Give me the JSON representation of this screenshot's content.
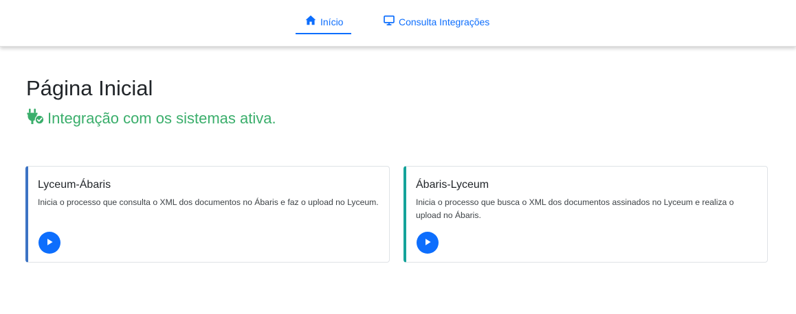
{
  "nav": {
    "items": [
      {
        "label": "Início",
        "icon": "home-icon",
        "active": true
      },
      {
        "label": "Consulta Integrações",
        "icon": "monitor-icon",
        "active": false
      }
    ]
  },
  "main": {
    "title": "Página Inicial",
    "status": {
      "text": "Integração com os sistemas ativa.",
      "icon": "plug-check-icon"
    }
  },
  "cards": [
    {
      "title": "Lyceum-Ábaris",
      "description": "Inicia o processo que consulta o XML dos documentos no Ábaris e faz o upload no Lyceum.",
      "action_icon": "play-icon"
    },
    {
      "title": "Ábaris-Lyceum",
      "description": "Inicia o processo que busca o XML dos documentos assinados no Lyceum e realiza o upload no Ábaris.",
      "action_icon": "play-icon"
    }
  ],
  "colors": {
    "accent": "#0d6efd",
    "status_green": "#3aae6b",
    "card_left_border": "#3c73c4",
    "card_right_border": "#14a39a"
  }
}
